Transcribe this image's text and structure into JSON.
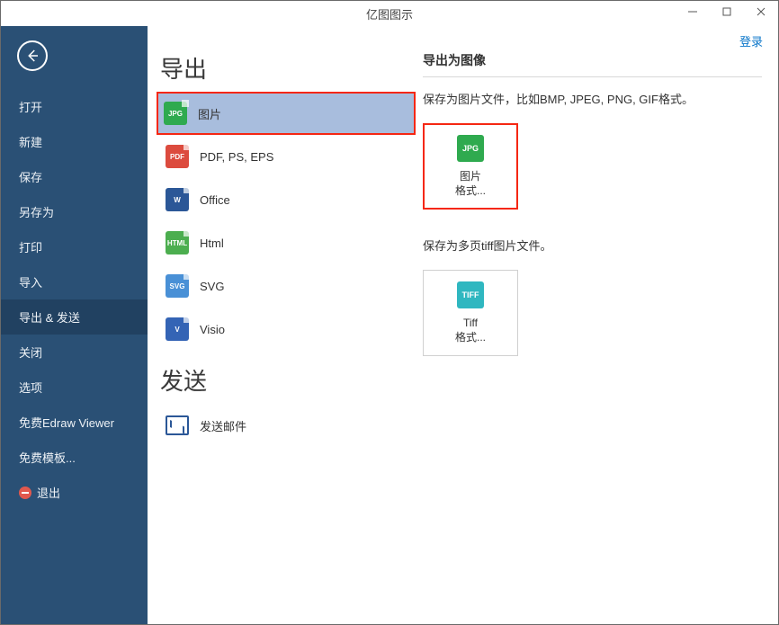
{
  "app_title": "亿图图示",
  "login_label": "登录",
  "sidebar": {
    "back_name": "back-button",
    "items": [
      {
        "label": "打开"
      },
      {
        "label": "新建"
      },
      {
        "label": "保存"
      },
      {
        "label": "另存为"
      },
      {
        "label": "打印"
      },
      {
        "label": "导入"
      },
      {
        "label": "导出 & 发送",
        "active": true
      },
      {
        "label": "关闭"
      },
      {
        "label": "选项"
      },
      {
        "label": "免费Edraw Viewer"
      },
      {
        "label": "免费模板..."
      },
      {
        "label": "退出",
        "exit": true
      }
    ]
  },
  "export": {
    "heading": "导出",
    "items": [
      {
        "label": "图片",
        "icon": "jpg",
        "selected": true
      },
      {
        "label": "PDF, PS, EPS",
        "icon": "pdf"
      },
      {
        "label": "Office",
        "icon": "word"
      },
      {
        "label": "Html",
        "icon": "html"
      },
      {
        "label": "SVG",
        "icon": "svg"
      },
      {
        "label": "Visio",
        "icon": "visio"
      }
    ]
  },
  "send": {
    "heading": "发送",
    "items": [
      {
        "label": "发送邮件",
        "icon": "mail"
      }
    ]
  },
  "right": {
    "title": "导出为图像",
    "desc1": "保存为图片文件，比如BMP, JPEG, PNG, GIF格式。",
    "tile1": {
      "line1": "图片",
      "line2": "格式..."
    },
    "desc2": "保存为多页tiff图片文件。",
    "tile2": {
      "line1": "Tiff",
      "line2": "格式..."
    }
  },
  "icon_text": {
    "jpg": "JPG",
    "pdf": "PDF",
    "word": "W",
    "html": "HTML",
    "svg": "SVG",
    "visio": "V",
    "tiff": "TIFF"
  }
}
